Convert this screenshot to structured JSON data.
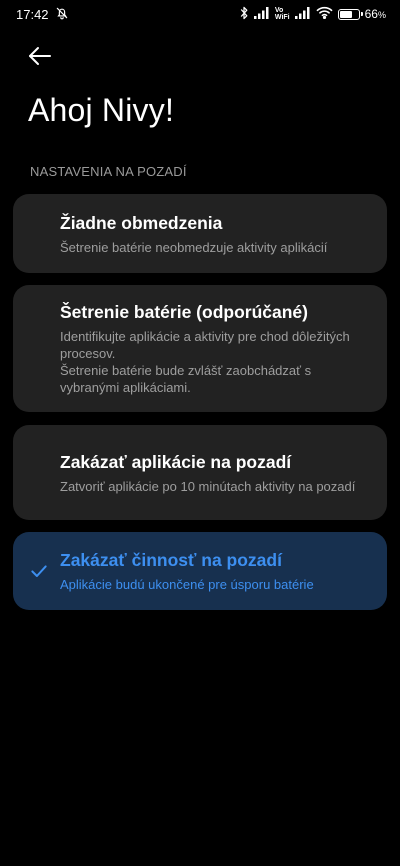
{
  "status_bar": {
    "time": "17:42",
    "vo_top": "Vo",
    "vo_bottom": "WiFi",
    "battery_percent": "66",
    "battery_unit": "%",
    "battery_level": 0.66
  },
  "page": {
    "title": "Ahoj Nivy!",
    "section_header": "NASTAVENIA NA POZADÍ"
  },
  "options": [
    {
      "title": "Žiadne obmedzenia",
      "desc": "Šetrenie batérie neobmedzuje aktivity aplikácií",
      "selected": false
    },
    {
      "title": "Šetrenie batérie (odporúčané)",
      "desc_line1": "Identifikujte aplikácie a aktivity pre chod dôležitých procesov.",
      "desc_line2": "Šetrenie batérie bude zvlášť zaobchádzať s vybranými aplikáciami.",
      "selected": false
    },
    {
      "title": "Zakázať aplikácie na pozadí",
      "desc": "Zatvoriť aplikácie po 10 minútach aktivity na pozadí",
      "selected": false
    },
    {
      "title": "Zakázať činnosť na pozadí",
      "desc": "Aplikácie budú ukončené pre úsporu batérie",
      "selected": true
    }
  ],
  "colors": {
    "background": "#000000",
    "card": "#222222",
    "selected_card": "#17304f",
    "accent": "#3d8ff0"
  }
}
